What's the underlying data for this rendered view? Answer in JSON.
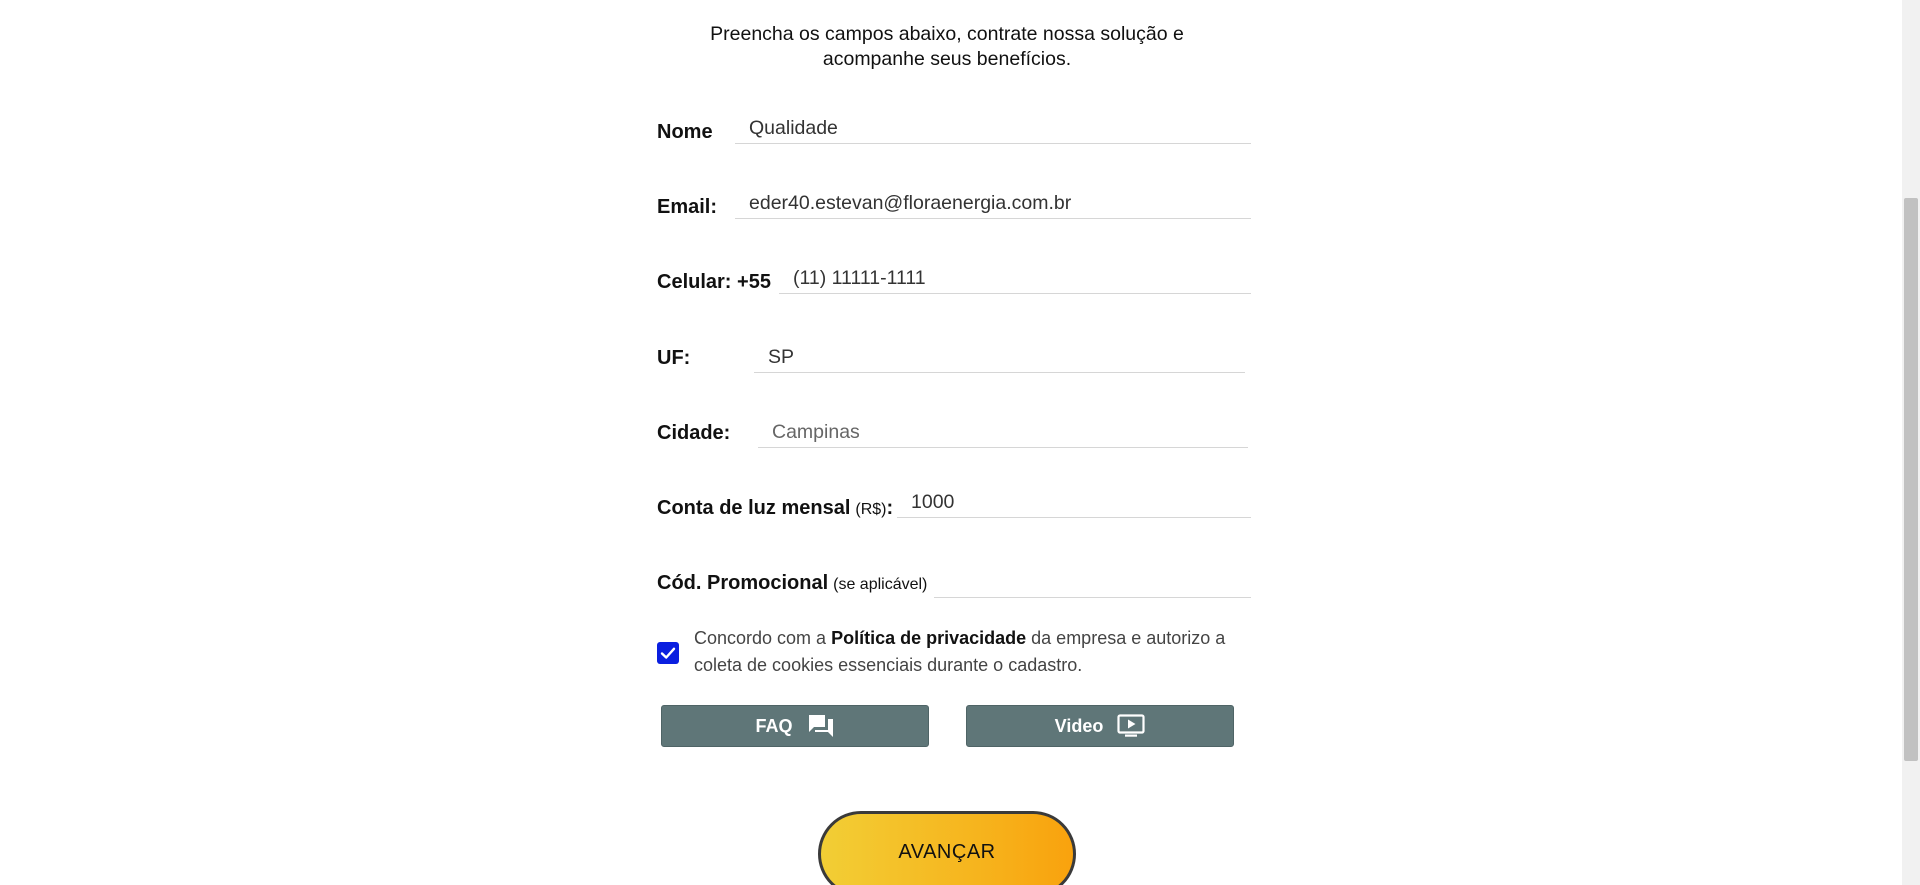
{
  "intro": {
    "line1": "Preencha os campos abaixo, contrate nossa solução e",
    "line2": "acompanhe seus benefícios."
  },
  "form": {
    "nome": {
      "label": "Nome",
      "value": "Qualidade"
    },
    "email": {
      "label": "Email:",
      "value": "eder40.estevan@floraenergia.com.br"
    },
    "celular": {
      "label": "Celular: +55",
      "value": "(11) 11111-1111"
    },
    "uf": {
      "label": "UF:",
      "value": "SP"
    },
    "cidade": {
      "label": "Cidade:",
      "value": "Campinas"
    },
    "conta": {
      "label": "Conta de luz mensal",
      "unit": "(R$)",
      "colon": ":",
      "value": "1000"
    },
    "promo": {
      "label": "Cód. Promocional",
      "hint": "(se aplicável)",
      "value": ""
    }
  },
  "consent": {
    "checked": true,
    "text_before": "Concordo com a ",
    "link_text": "Política de privacidade",
    "text_after": " da empresa e autorizo a coleta de cookies essenciais durante o cadastro."
  },
  "buttons": {
    "faq": {
      "label": "FAQ",
      "icon": "chat-icon"
    },
    "video": {
      "label": "Video",
      "icon": "video-play-icon"
    },
    "advance": {
      "label": "AVANÇAR"
    }
  },
  "colors": {
    "checkbox": "#0a1fe0",
    "gray_button": "#5f7678",
    "advance_start": "#f2ce35",
    "advance_end": "#f9a20d"
  }
}
